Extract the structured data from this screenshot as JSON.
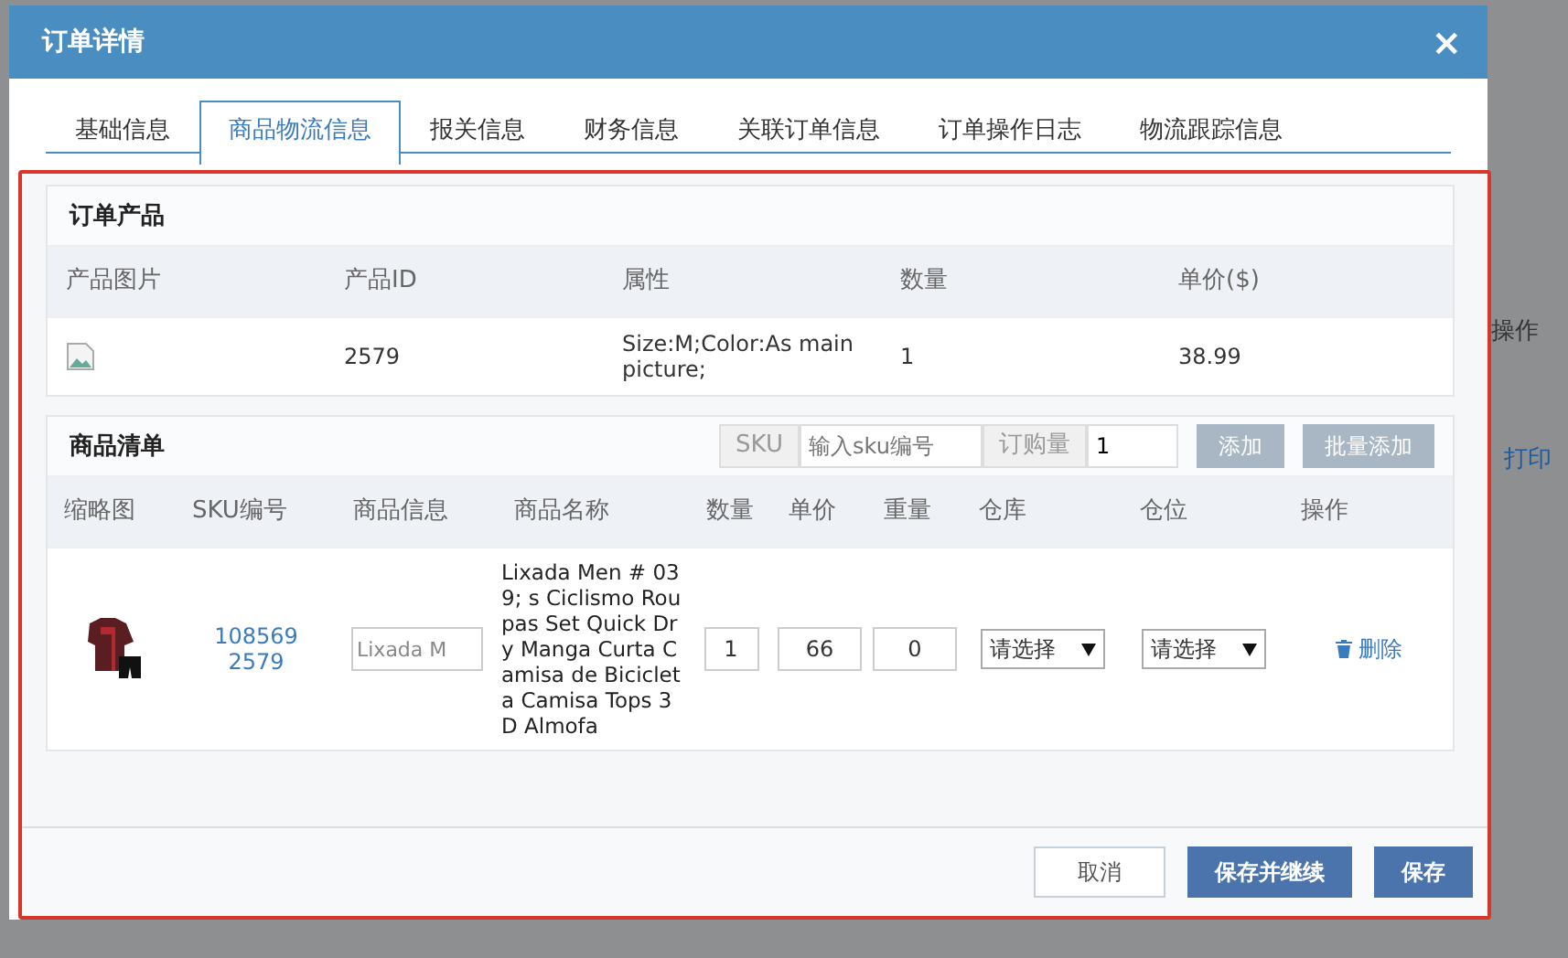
{
  "background": {
    "texts": [
      "操作",
      "打印"
    ]
  },
  "window": {
    "title": "订单详情",
    "close": "×"
  },
  "tabs": [
    {
      "label": "基础信息",
      "selected": false
    },
    {
      "label": "商品物流信息",
      "selected": true
    },
    {
      "label": "报关信息",
      "selected": false
    },
    {
      "label": "财务信息",
      "selected": false
    },
    {
      "label": "关联订单信息",
      "selected": false
    },
    {
      "label": "订单操作日志",
      "selected": false
    },
    {
      "label": "物流跟踪信息",
      "selected": false
    }
  ],
  "order_products": {
    "title": "订单产品",
    "columns": [
      "产品图片",
      "产品ID",
      "属性",
      "数量",
      "单价($)"
    ],
    "rows": [
      {
        "product_id": "2579",
        "attributes": "Size:M;Color:As main picture;",
        "quantity": "1",
        "unit_price": "38.99"
      }
    ]
  },
  "item_list": {
    "title": "商品清单",
    "sku_label": "SKU",
    "sku_placeholder": "输入sku编号",
    "qty_label": "订购量",
    "qty_value": "1",
    "buttons": [
      {
        "label": "添加",
        "disabled": true
      },
      {
        "label": "批量添加",
        "disabled": true
      }
    ],
    "columns": [
      "缩略图",
      "SKU编号",
      "商品信息",
      "商品名称",
      "数量",
      "单价",
      "重量",
      "仓库",
      "仓位",
      "操作"
    ],
    "rows": [
      {
        "sku": "108569 2579",
        "info_value": "Lixada M",
        "name": "Lixada Men # 039; s Ciclismo Roupas Set Quick Dry Manga Curta Camisa de Bicicleta Camisa Tops 3D Almofa",
        "quantity": "1",
        "price": "66",
        "weight": "0",
        "warehouse": "请选择",
        "location": "请选择",
        "delete": "删除"
      }
    ]
  },
  "footer": {
    "buttons": [
      {
        "label": "取消",
        "kind": "secondary"
      },
      {
        "label": "保存并继续",
        "kind": "primary"
      },
      {
        "label": "保存",
        "kind": "primary"
      }
    ]
  }
}
